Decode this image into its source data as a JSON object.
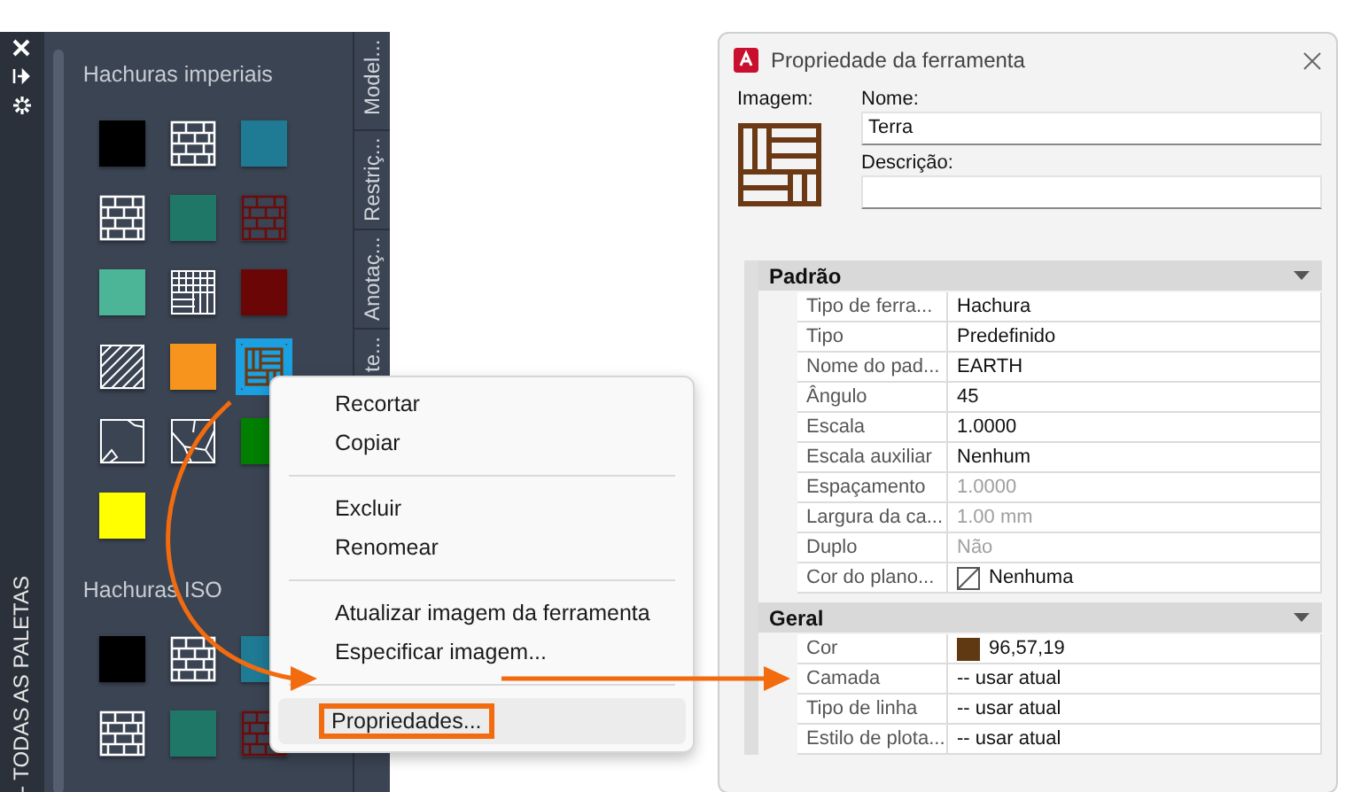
{
  "palette": {
    "strip_title": "- TODAS AS PALETAS",
    "sections": [
      {
        "title": "Hachuras imperiais",
        "swatches": [
          {
            "kind": "solid",
            "color": "#000000",
            "selected": false
          },
          {
            "kind": "brick",
            "color": "#ffffff",
            "selected": false
          },
          {
            "kind": "solid",
            "color": "#1f7a94",
            "selected": false
          },
          {
            "kind": "brick",
            "color": "#ffffff",
            "selected": false
          },
          {
            "kind": "solid",
            "color": "#1f7767",
            "selected": false
          },
          {
            "kind": "brick",
            "color": "#6b0b0b",
            "selected": false
          },
          {
            "kind": "solid",
            "color": "#4db597",
            "selected": false
          },
          {
            "kind": "grid",
            "color": "#ffffff",
            "selected": false
          },
          {
            "kind": "solid",
            "color": "#6b0606",
            "selected": false
          },
          {
            "kind": "diagonal",
            "color": "#ffffff",
            "selected": false
          },
          {
            "kind": "solid",
            "color": "#f7941d",
            "selected": false
          },
          {
            "kind": "earth",
            "color": "#6b3a14",
            "selected": true
          },
          {
            "kind": "sketch",
            "color": "#ffffff",
            "selected": false
          },
          {
            "kind": "cracks",
            "color": "#ffffff",
            "selected": false
          },
          {
            "kind": "solid",
            "color": "#007f00",
            "selected": false
          },
          {
            "kind": "solid",
            "color": "#ffff00",
            "selected": false
          }
        ]
      },
      {
        "title": "Hachuras ISO",
        "swatches": [
          {
            "kind": "solid",
            "color": "#000000",
            "selected": false
          },
          {
            "kind": "brick",
            "color": "#ffffff",
            "selected": false
          },
          {
            "kind": "solid",
            "color": "#1f7a94",
            "selected": false
          },
          {
            "kind": "brick",
            "color": "#ffffff",
            "selected": false
          },
          {
            "kind": "solid",
            "color": "#1f7767",
            "selected": false
          },
          {
            "kind": "brick",
            "color": "#6b0b0b",
            "selected": false
          }
        ]
      }
    ],
    "tabs": [
      {
        "label": "Model..."
      },
      {
        "label": "Restriç..."
      },
      {
        "label": "Anotaç..."
      },
      {
        "label": "te..."
      }
    ]
  },
  "context_menu": {
    "items": [
      {
        "kind": "item",
        "label": "Recortar",
        "selected": false
      },
      {
        "kind": "item",
        "label": "Copiar",
        "selected": false
      },
      {
        "kind": "separator"
      },
      {
        "kind": "item",
        "label": "Excluir",
        "selected": false
      },
      {
        "kind": "item",
        "label": "Renomear",
        "selected": false
      },
      {
        "kind": "separator"
      },
      {
        "kind": "item",
        "label": "Atualizar imagem da ferramenta",
        "selected": false
      },
      {
        "kind": "item",
        "label": "Especificar imagem...",
        "selected": false
      },
      {
        "kind": "separator"
      },
      {
        "kind": "item",
        "label": "Propriedades...",
        "selected": true
      }
    ]
  },
  "dialog": {
    "title": "Propriedade da ferramenta",
    "image_label": "Imagem:",
    "name_label": "Nome:",
    "name_value": "Terra",
    "description_label": "Descrição:",
    "sections": [
      {
        "title": "Padrão",
        "expanded": true,
        "rows": [
          {
            "kind": "text",
            "label": "Tipo de ferra...",
            "value": "Hachura",
            "disabled": false
          },
          {
            "kind": "text",
            "label": "Tipo",
            "value": "Predefinido",
            "disabled": false
          },
          {
            "kind": "text",
            "label": "Nome do pad...",
            "value": "EARTH",
            "disabled": false
          },
          {
            "kind": "text",
            "label": "Ângulo",
            "value": "45",
            "disabled": false
          },
          {
            "kind": "text",
            "label": "Escala",
            "value": "1.0000",
            "disabled": false
          },
          {
            "kind": "text",
            "label": "Escala auxiliar",
            "value": "Nenhum",
            "disabled": false
          },
          {
            "kind": "text",
            "label": "Espaçamento",
            "value": "1.0000",
            "disabled": true
          },
          {
            "kind": "text",
            "label": "Largura da ca...",
            "value": "1.00 mm",
            "disabled": true
          },
          {
            "kind": "text",
            "label": "Duplo",
            "value": "Não",
            "disabled": true
          },
          {
            "kind": "no-color",
            "label": "Cor do plano...",
            "value": "Nenhuma",
            "disabled": false
          }
        ]
      },
      {
        "title": "Geral",
        "expanded": true,
        "rows": [
          {
            "kind": "color",
            "label": "Cor",
            "value": "96,57,19",
            "color": "#603913",
            "disabled": false
          },
          {
            "kind": "text",
            "label": "Camada",
            "value": "-- usar atual",
            "disabled": false
          },
          {
            "kind": "text",
            "label": "Tipo de linha",
            "value": "-- usar atual",
            "disabled": false
          },
          {
            "kind": "text",
            "label": "Estilo de plota...",
            "value": "-- usar atual",
            "disabled": false
          }
        ]
      }
    ]
  }
}
